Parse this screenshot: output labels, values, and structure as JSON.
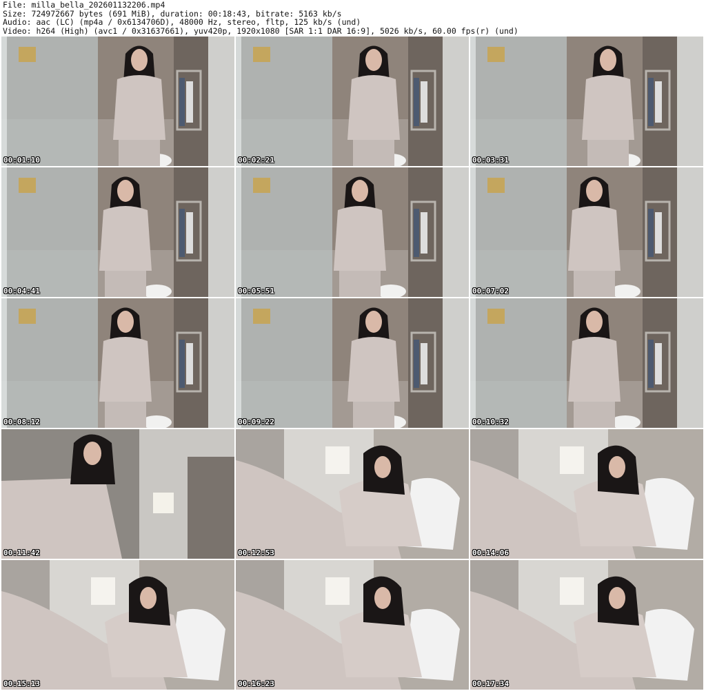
{
  "header": {
    "line1": "File: milla_bella_202601132206.mp4",
    "line2": "Size: 724972667 bytes (691 MiB), duration: 00:18:43, bitrate: 5163 kb/s",
    "line3": "Audio: aac (LC) (mp4a / 0x6134706D), 48000 Hz, stereo, fltp, 125 kb/s (und)",
    "line4": "Video: h264 (High) (avc1 / 0x31637661), yuv420p, 1920x1080 [SAR 1:1 DAR 16:9], 5026 kb/s, 60.00 fps(r) (und)"
  },
  "thumbnails": [
    {
      "time": "00:01:10",
      "scene": "bathroom"
    },
    {
      "time": "00:02:21",
      "scene": "bathroom"
    },
    {
      "time": "00:03:31",
      "scene": "bathroom"
    },
    {
      "time": "00:04:41",
      "scene": "bathroom"
    },
    {
      "time": "00:05:51",
      "scene": "bathroom"
    },
    {
      "time": "00:07:02",
      "scene": "bathroom"
    },
    {
      "time": "00:08:12",
      "scene": "bathroom"
    },
    {
      "time": "00:09:22",
      "scene": "bathroom"
    },
    {
      "time": "00:10:32",
      "scene": "bathroom"
    },
    {
      "time": "00:11:42",
      "scene": "bedroom-standing"
    },
    {
      "time": "00:12:53",
      "scene": "bed"
    },
    {
      "time": "00:14:06",
      "scene": "bed"
    },
    {
      "time": "00:15:13",
      "scene": "bed"
    },
    {
      "time": "00:16:23",
      "scene": "bed"
    },
    {
      "time": "00:17:34",
      "scene": "bed"
    }
  ],
  "colors": {
    "bathroom_wall": "#8f847b",
    "glass": "#b9c2c2",
    "bed_wall": "#d8d6d2",
    "headboard": "#b2aca5",
    "pillow": "#f2f2f2",
    "hair": "#1a1616",
    "sweater": "#cfc5c1",
    "skin": "#d9b9a8"
  }
}
